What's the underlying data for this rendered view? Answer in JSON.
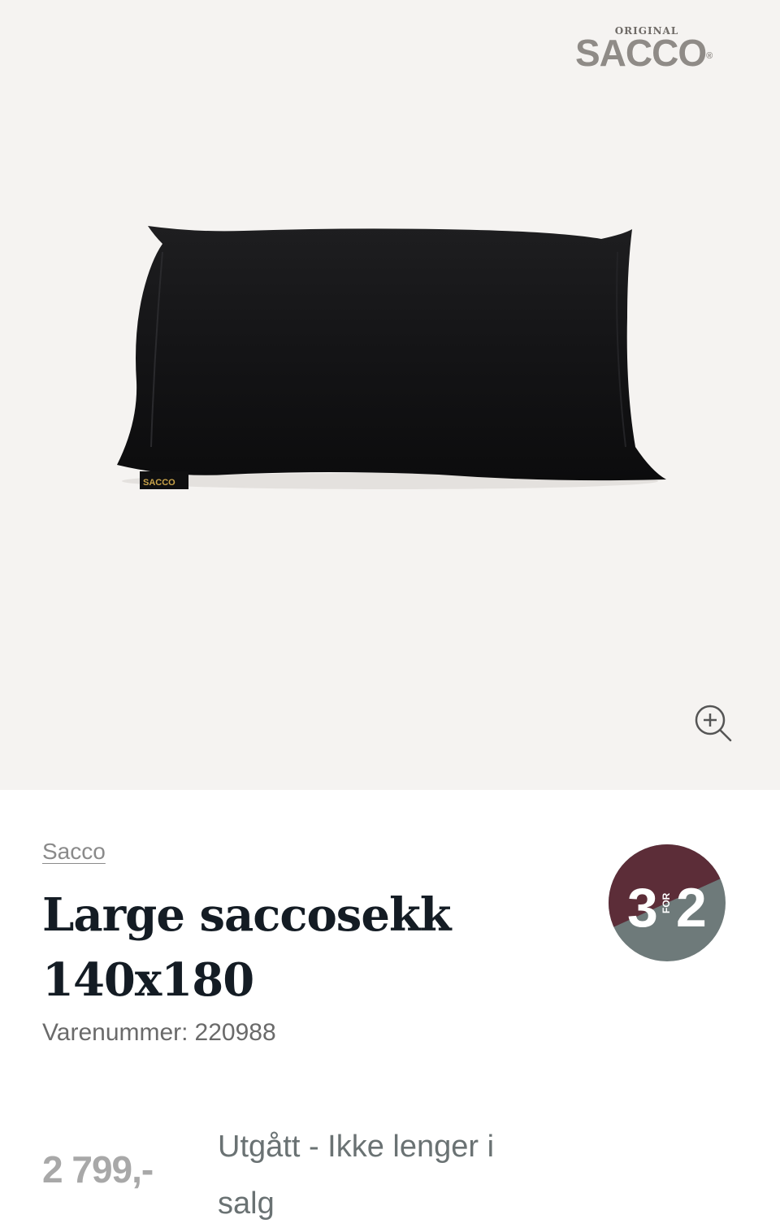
{
  "brand_logo": {
    "small": "ORIGINAL",
    "word": "SACCO",
    "registered": "®"
  },
  "product_image": {
    "label_text": "SACCO"
  },
  "zoom": {
    "icon": "zoom-in-icon"
  },
  "product": {
    "brand": "Sacco",
    "title": "Large saccosekk 140x180",
    "sku_label": "Varenummer:",
    "sku_value": "220988",
    "price": "2 799,-",
    "status": "Utgått - Ikke lenger i salg"
  },
  "badge": {
    "big": "3",
    "small": "FOR",
    "big2": "2",
    "colors": {
      "top": "#5c2d38",
      "bottom": "#6e7a7a"
    }
  },
  "colors": {
    "hero_bg": "#f5f3f1",
    "title": "#141c24",
    "price": "#a8a8a8",
    "status": "#6a7273"
  }
}
